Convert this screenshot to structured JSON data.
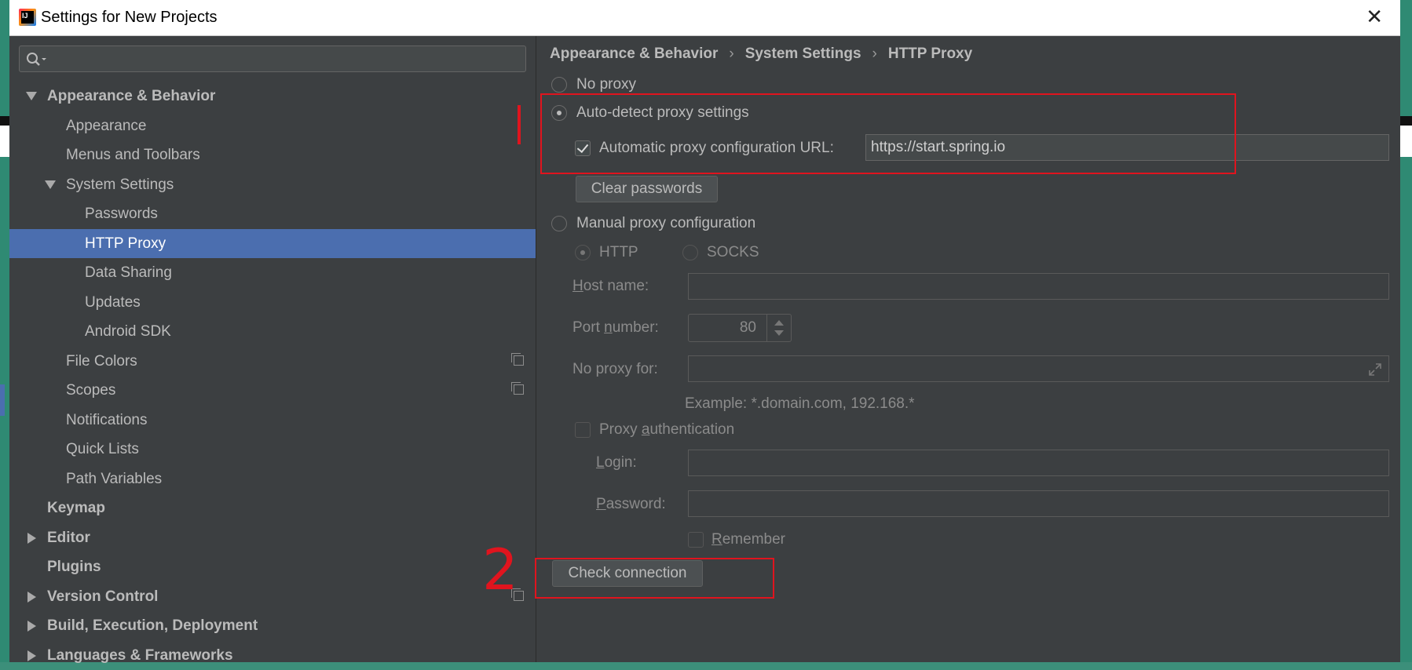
{
  "window": {
    "title": "Settings for New Projects"
  },
  "search": {
    "placeholder": ""
  },
  "tree": {
    "items": [
      {
        "label": "Appearance & Behavior"
      },
      {
        "label": "Appearance"
      },
      {
        "label": "Menus and Toolbars"
      },
      {
        "label": "System Settings"
      },
      {
        "label": "Passwords"
      },
      {
        "label": "HTTP Proxy"
      },
      {
        "label": "Data Sharing"
      },
      {
        "label": "Updates"
      },
      {
        "label": "Android SDK"
      },
      {
        "label": "File Colors"
      },
      {
        "label": "Scopes"
      },
      {
        "label": "Notifications"
      },
      {
        "label": "Quick Lists"
      },
      {
        "label": "Path Variables"
      },
      {
        "label": "Keymap"
      },
      {
        "label": "Editor"
      },
      {
        "label": "Plugins"
      },
      {
        "label": "Version Control"
      },
      {
        "label": "Build, Execution, Deployment"
      },
      {
        "label": "Languages & Frameworks"
      }
    ]
  },
  "breadcrumb": {
    "part1": "Appearance & Behavior",
    "part2": "System Settings",
    "part3": "HTTP Proxy",
    "separator": "›"
  },
  "proxy": {
    "no_proxy": "No proxy",
    "auto_detect": "Auto-detect proxy settings",
    "auto_url_label": "Automatic proxy configuration URL:",
    "auto_url_value": "https://start.spring.io",
    "clear_passwords": "Clear passwords",
    "manual": "Manual proxy configuration",
    "http": "HTTP",
    "socks": "SOCKS",
    "host_label_u": "H",
    "host_label_rest": "ost name:",
    "port_label_pre": "Port ",
    "port_label_u": "n",
    "port_label_rest": "umber:",
    "port_value": "80",
    "no_proxy_for": "No proxy for:",
    "example": "Example: *.domain.com, 192.168.*",
    "auth_pre": "Proxy ",
    "auth_u": "a",
    "auth_rest": "uthentication",
    "login_u": "L",
    "login_rest": "ogin:",
    "password_u": "P",
    "password_rest": "assword:",
    "remember_u": "R",
    "remember_rest": "emember",
    "check_connection": "Check connection"
  },
  "annotations": {
    "mark1": "|",
    "mark2": "2"
  },
  "colors": {
    "accent": "#4b6eaf",
    "annotation": "#e0141e",
    "panel": "#3c3f41"
  },
  "icons": {
    "search": "search-icon",
    "close": "close-icon",
    "copy": "copy-icon",
    "expand": "expand-icon"
  }
}
